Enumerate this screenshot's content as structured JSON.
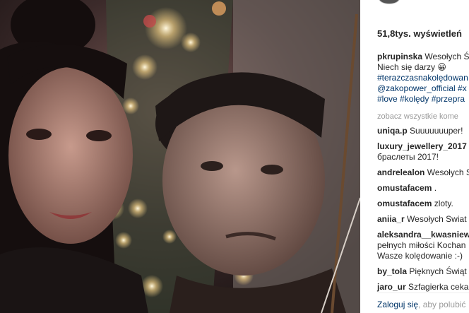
{
  "photo": {
    "alt": "selfie in front of christmas tree"
  },
  "views": "51,8tys. wyświetleń",
  "caption": {
    "user": "pkrupinska",
    "text1": "Wesołych Ś",
    "text2": "Niech się darzy 😀",
    "tags": [
      "#terazczasnakolędowan",
      "@zakopower_official #x",
      "#love #kolędy #przepra"
    ]
  },
  "see_all": "zobacz wszystkie kome",
  "comments": [
    {
      "user": "uniqa.p",
      "text": "Suuuuuuuper!",
      "line2": ""
    },
    {
      "user": "luxury_jewellery_2017",
      "text": "",
      "line2": "браслеты 2017!"
    },
    {
      "user": "andrelealon",
      "text": "Wesołych S",
      "line2": ""
    },
    {
      "user": "omustafacem",
      "text": ".",
      "line2": ""
    },
    {
      "user": "omustafacem",
      "text": "zloty.",
      "line2": ""
    },
    {
      "user": "aniia_r",
      "text": "Wesołych Swiat",
      "line2": ""
    },
    {
      "user": "aleksandra__kwasniew",
      "text": "",
      "line2": "pełnych miłości Kochan",
      "line3": "Wasze kolędowanie :-)"
    },
    {
      "user": "by_tola",
      "text": "Pięknych Świąt",
      "line2": ""
    },
    {
      "user": "jaro_ur",
      "text": "Szfagierka ceka",
      "line2": ""
    }
  ],
  "footer": {
    "login": "Zaloguj się",
    "rest": ", aby polubić"
  }
}
